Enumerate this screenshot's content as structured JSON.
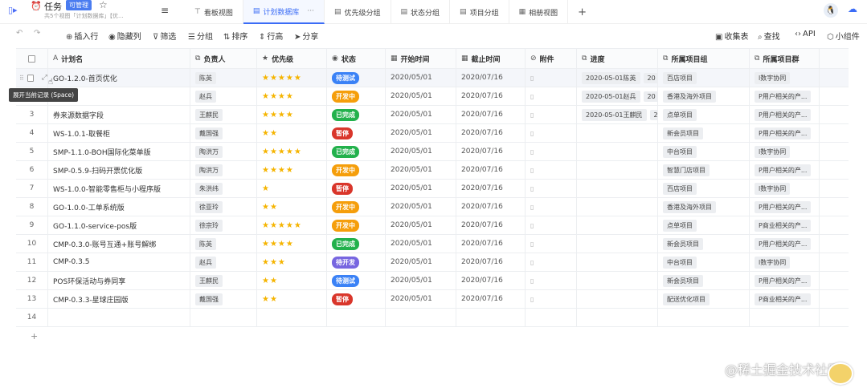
{
  "app": {
    "title": "任务",
    "permission": "可管理",
    "subtitle": "共5个视图「计划数据库」【优..."
  },
  "tabs": [
    {
      "label": "看板视图",
      "icon": "kanban-icon",
      "glyph": "⊤"
    },
    {
      "label": "计划数据库",
      "icon": "table-icon",
      "glyph": "▤",
      "active": true
    },
    {
      "label": "优先级分组",
      "icon": "table-icon",
      "glyph": "▤"
    },
    {
      "label": "状态分组",
      "icon": "table-icon",
      "glyph": "▤"
    },
    {
      "label": "项目分组",
      "icon": "table-icon",
      "glyph": "▤"
    },
    {
      "label": "相册视图",
      "icon": "gallery-icon",
      "glyph": "▦"
    }
  ],
  "toolbar": {
    "insert": "插入行",
    "hide": "隐藏列",
    "filter": "筛选",
    "group": "分组",
    "sort": "排序",
    "row_height": "行高",
    "share": "分享",
    "collect_form": "收集表",
    "find": "查找",
    "api": "API",
    "widget": "小组件"
  },
  "columns": {
    "name": "计划名",
    "owner": "负责人",
    "priority": "优先级",
    "status": "状态",
    "start": "开始时间",
    "end": "截止时间",
    "attachment": "附件",
    "progress": "进度",
    "project": "所属项目组",
    "group": "所属项目群"
  },
  "tooltip": "展开当前记录 (Space)",
  "status_colors": {
    "待测试": "#3b82f6",
    "开发中": "#f59e0b",
    "已完成": "#22b14c",
    "暂停": "#d9362b",
    "待开发": "#7766e0"
  },
  "rows": [
    {
      "idx": "1",
      "name": "GO-1.2.0-首页优化",
      "owner": "陈英",
      "stars": "★★★★★",
      "status": "待测试",
      "start": "2020/05/01",
      "end": "2020/07/16",
      "progress": [
        "2020-05-01陈英",
        "20"
      ],
      "project": "百店项目",
      "group": "l数字协同"
    },
    {
      "idx": "2",
      "name": "...版",
      "owner": "赵兵",
      "stars": "★★★★",
      "status": "开发中",
      "start": "2020/05/01",
      "end": "2020/07/16",
      "progress": [
        "2020-05-01赵兵",
        "20"
      ],
      "project": "香港及海外项目",
      "group": "P用户相关的产..."
    },
    {
      "idx": "3",
      "name": "券来源数据字段",
      "owner": "王麒民",
      "stars": "★★★★",
      "status": "已完成",
      "start": "2020/05/01",
      "end": "2020/07/16",
      "progress": [
        "2020-05-01王麒民",
        "20"
      ],
      "project": "点单项目",
      "group": "P用户相关的产..."
    },
    {
      "idx": "4",
      "name": "WS-1.0.1-取餐柜",
      "owner": "戴国强",
      "stars": "★★",
      "status": "暂停",
      "start": "2020/05/01",
      "end": "2020/07/16",
      "progress": [],
      "project": "新会员项目",
      "group": "P用户相关的产..."
    },
    {
      "idx": "5",
      "name": "SMP-1.1.0-BOH国际化菜单版",
      "owner": "陶洪万",
      "stars": "★★★★★",
      "status": "已完成",
      "start": "2020/05/01",
      "end": "2020/07/16",
      "progress": [],
      "project": "中台项目",
      "group": "l数字协同"
    },
    {
      "idx": "6",
      "name": "SMP-0.5.9-扫码开票优化版",
      "owner": "陶洪万",
      "stars": "★★★★",
      "status": "开发中",
      "start": "2020/05/01",
      "end": "2020/07/16",
      "progress": [],
      "project": "智慧门店项目",
      "group": "P用户相关的产..."
    },
    {
      "idx": "7",
      "name": "WS-1.0.0-智能零售柜与小程序版",
      "owner": "朱洪纬",
      "stars": "★",
      "status": "暂停",
      "start": "2020/05/01",
      "end": "2020/07/16",
      "progress": [],
      "project": "百店项目",
      "group": "l数字协同"
    },
    {
      "idx": "8",
      "name": "GO-1.0.0-工单系统版",
      "owner": "徐亚玲",
      "stars": "★★",
      "status": "开发中",
      "start": "2020/05/01",
      "end": "2020/07/16",
      "progress": [],
      "project": "香港及海外项目",
      "group": "P用户相关的产..."
    },
    {
      "idx": "9",
      "name": "GO-1.1.0-service-pos版",
      "owner": "徐宗玲",
      "stars": "★★★★★",
      "status": "开发中",
      "start": "2020/05/01",
      "end": "2020/07/16",
      "progress": [],
      "project": "点单项目",
      "group": "P商业相关的产..."
    },
    {
      "idx": "10",
      "name": "CMP-0.3.0-账号互通+账号解绑",
      "owner": "陈英",
      "stars": "★★★★",
      "status": "已完成",
      "start": "2020/05/01",
      "end": "2020/07/16",
      "progress": [],
      "project": "新会员项目",
      "group": "P用户相关的产..."
    },
    {
      "idx": "11",
      "name": "CMP-0.3.5",
      "owner": "赵兵",
      "stars": "★★★",
      "status": "待开发",
      "start": "2020/05/01",
      "end": "2020/07/16",
      "progress": [],
      "project": "中台项目",
      "group": "l数字协同"
    },
    {
      "idx": "12",
      "name": "POS环保活动与券同享",
      "owner": "王麒民",
      "stars": "★★",
      "status": "待测试",
      "start": "2020/05/01",
      "end": "2020/07/16",
      "progress": [],
      "project": "新会员项目",
      "group": "P用户相关的产..."
    },
    {
      "idx": "13",
      "name": "CMP-0.3.3-星球庄园版",
      "owner": "戴国强",
      "stars": "★★",
      "status": "暂停",
      "start": "2020/05/01",
      "end": "2020/07/16",
      "progress": [],
      "project": "配送优化项目",
      "group": "P商业相关的产..."
    },
    {
      "idx": "14",
      "name": "",
      "owner": "",
      "stars": "",
      "status": "",
      "start": "",
      "end": "",
      "progress": [],
      "project": "",
      "group": ""
    }
  ],
  "watermark": "@稀土掘金技术社区"
}
